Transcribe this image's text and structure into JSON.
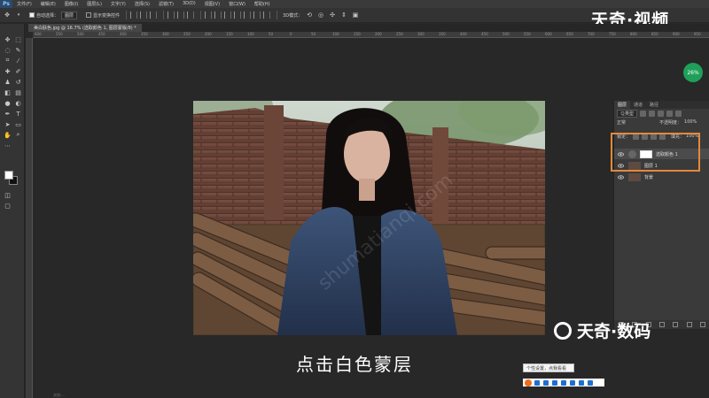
{
  "menubar": {
    "logo": "Ps",
    "items": [
      "文件(F)",
      "编辑(E)",
      "图像(I)",
      "图层(L)",
      "文字(Y)",
      "选择(S)",
      "滤镜(T)",
      "3D(D)",
      "视图(V)",
      "窗口(W)",
      "帮助(H)"
    ]
  },
  "options": {
    "auto_select_label": "自动选择：",
    "auto_select_value": "图层",
    "show_transform_label": "显示变换控件"
  },
  "watermark_top": "天奇·视频",
  "document_tab": "美白肤色.jpg @ 16.7% (选取颜色 1, 图层蒙版/8) *",
  "ruler_ticks": [
    "600",
    "550",
    "500",
    "450",
    "400",
    "350",
    "300",
    "250",
    "200",
    "150",
    "100",
    "50",
    "0",
    "50",
    "100",
    "150",
    "200",
    "250",
    "300",
    "350",
    "400",
    "450",
    "500",
    "550",
    "600",
    "650",
    "700",
    "750",
    "800",
    "850",
    "900",
    "950"
  ],
  "zoom_badge": "26%",
  "layers_panel": {
    "tabs": [
      "图层",
      "通道",
      "路径"
    ],
    "filter_label": "Ｑ类型",
    "blend_mode": "正常",
    "opacity_label": "不透明度：",
    "opacity_value": "100%",
    "lock_label": "锁定：",
    "fill_label": "填充：",
    "fill_value": "100%",
    "layers": [
      {
        "name": "选取颜色 1"
      },
      {
        "name": "图层 1"
      },
      {
        "name": "背景"
      }
    ]
  },
  "subtitle": "点击白色蒙层",
  "watermark_bottom": "天奇·数码",
  "diagonal_watermark": "shumatianqi.com",
  "popup_text": "个性设置，点我看看",
  "status_text": "文档:..."
}
